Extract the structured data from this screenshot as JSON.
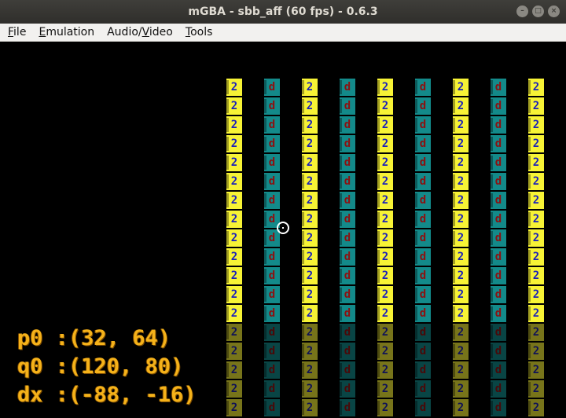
{
  "window": {
    "title": "mGBA - sbb_aff (60 fps) - 0.6.3",
    "buttons": [
      "minimize-icon",
      "maximize-icon",
      "close-icon"
    ]
  },
  "menu": [
    {
      "underline": "F",
      "rest": "ile"
    },
    {
      "underline": "E",
      "rest": "mulation"
    },
    {
      "pre": "Audio/",
      "underline": "V",
      "rest": "ideo"
    },
    {
      "underline": "T",
      "rest": "ools"
    }
  ],
  "game": {
    "tile_glyph_yellow": "2",
    "tile_glyph_teal": "d",
    "readout": {
      "p0_label": "p0",
      "p0_value": ":(32, 64)",
      "q0_label": "q0",
      "q0_value": ":(120, 80)",
      "dx_label": "dx",
      "dx_value": ":(-88, -16)"
    }
  },
  "colors": {
    "yellow_tile": "#f7f335",
    "teal_tile": "#138a8a",
    "readout_text": "#f5b21a"
  }
}
